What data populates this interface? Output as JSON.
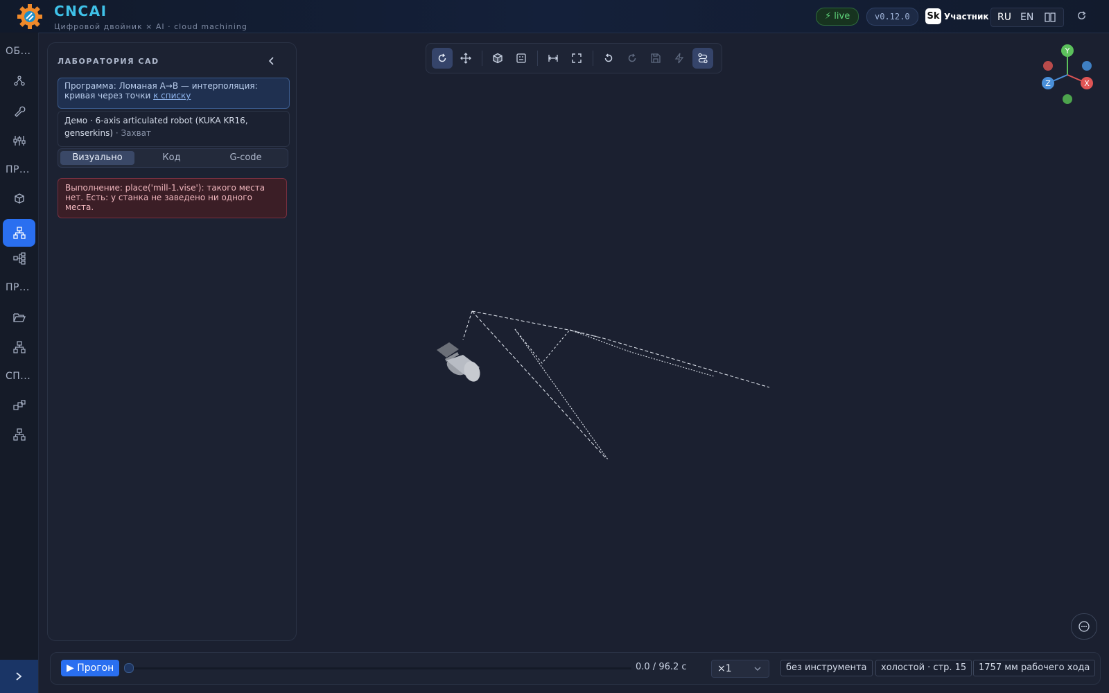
{
  "header": {
    "title": "CNCAI",
    "subtitle": "Цифровой двойник × AI · cloud machining",
    "live": "live",
    "version": "v0.12.0",
    "sk_logo": "Sk",
    "member": "Участник",
    "lang_ru": "RU",
    "lang_en": "EN",
    "accent_color": "#3fc1e8"
  },
  "sidebar": {
    "sections": [
      "ОБ...",
      "ПР...",
      "ПР...",
      "СП..."
    ],
    "icons": [
      "graph-nodes-icon",
      "wrench-icon",
      "sliders-icon",
      "cube-icon",
      "hierarchy-icon",
      "tree-icon",
      "folder-open-icon",
      "org-chart-icon",
      "blocks-icon",
      "network-icon"
    ],
    "active_icon": "hierarchy-icon",
    "expand_icon": "chevron-right-icon"
  },
  "cad": {
    "title": "ЛАБОРАТОРИЯ CAD",
    "program_text": "Программа: Ломаная A→B — интерполяция: кривая через точки",
    "program_link": "к списку",
    "demo_text": "Демо · 6-axis articulated robot (KUKA KR16, genserkins)",
    "demo_grip": "· Захват",
    "tabs": [
      "Визуально",
      "Код",
      "G-code"
    ],
    "active_tab": "Визуально",
    "error": "Выполнение: place('mill-1.vise'): такого места нет. Есть: у станка не заведено ни одного места."
  },
  "toolbar": {
    "buttons": [
      "orbit-icon",
      "pan-icon",
      "cube-view-icon",
      "frame-icon",
      "measure-icon",
      "fullscreen-icon",
      "undo-icon",
      "redo-icon",
      "save-icon",
      "bolt-icon",
      "path-icon"
    ],
    "active": [
      "orbit-icon",
      "path-icon"
    ]
  },
  "gizmo": {
    "x_label": "X",
    "y_label": "Y",
    "z_label": "Z",
    "x_color": "#e05555",
    "y_color": "#5cc15c",
    "z_color": "#4a8fd9"
  },
  "bottom": {
    "run_label": "▶ Прогон",
    "time": "0.0 / 96.2 с",
    "progress": 0.0,
    "speed": "×1",
    "tool_chip": "без инструмента",
    "idle_chip": "холостой · стр. 15",
    "travel_chip": "1757 мм рабочего хода"
  }
}
